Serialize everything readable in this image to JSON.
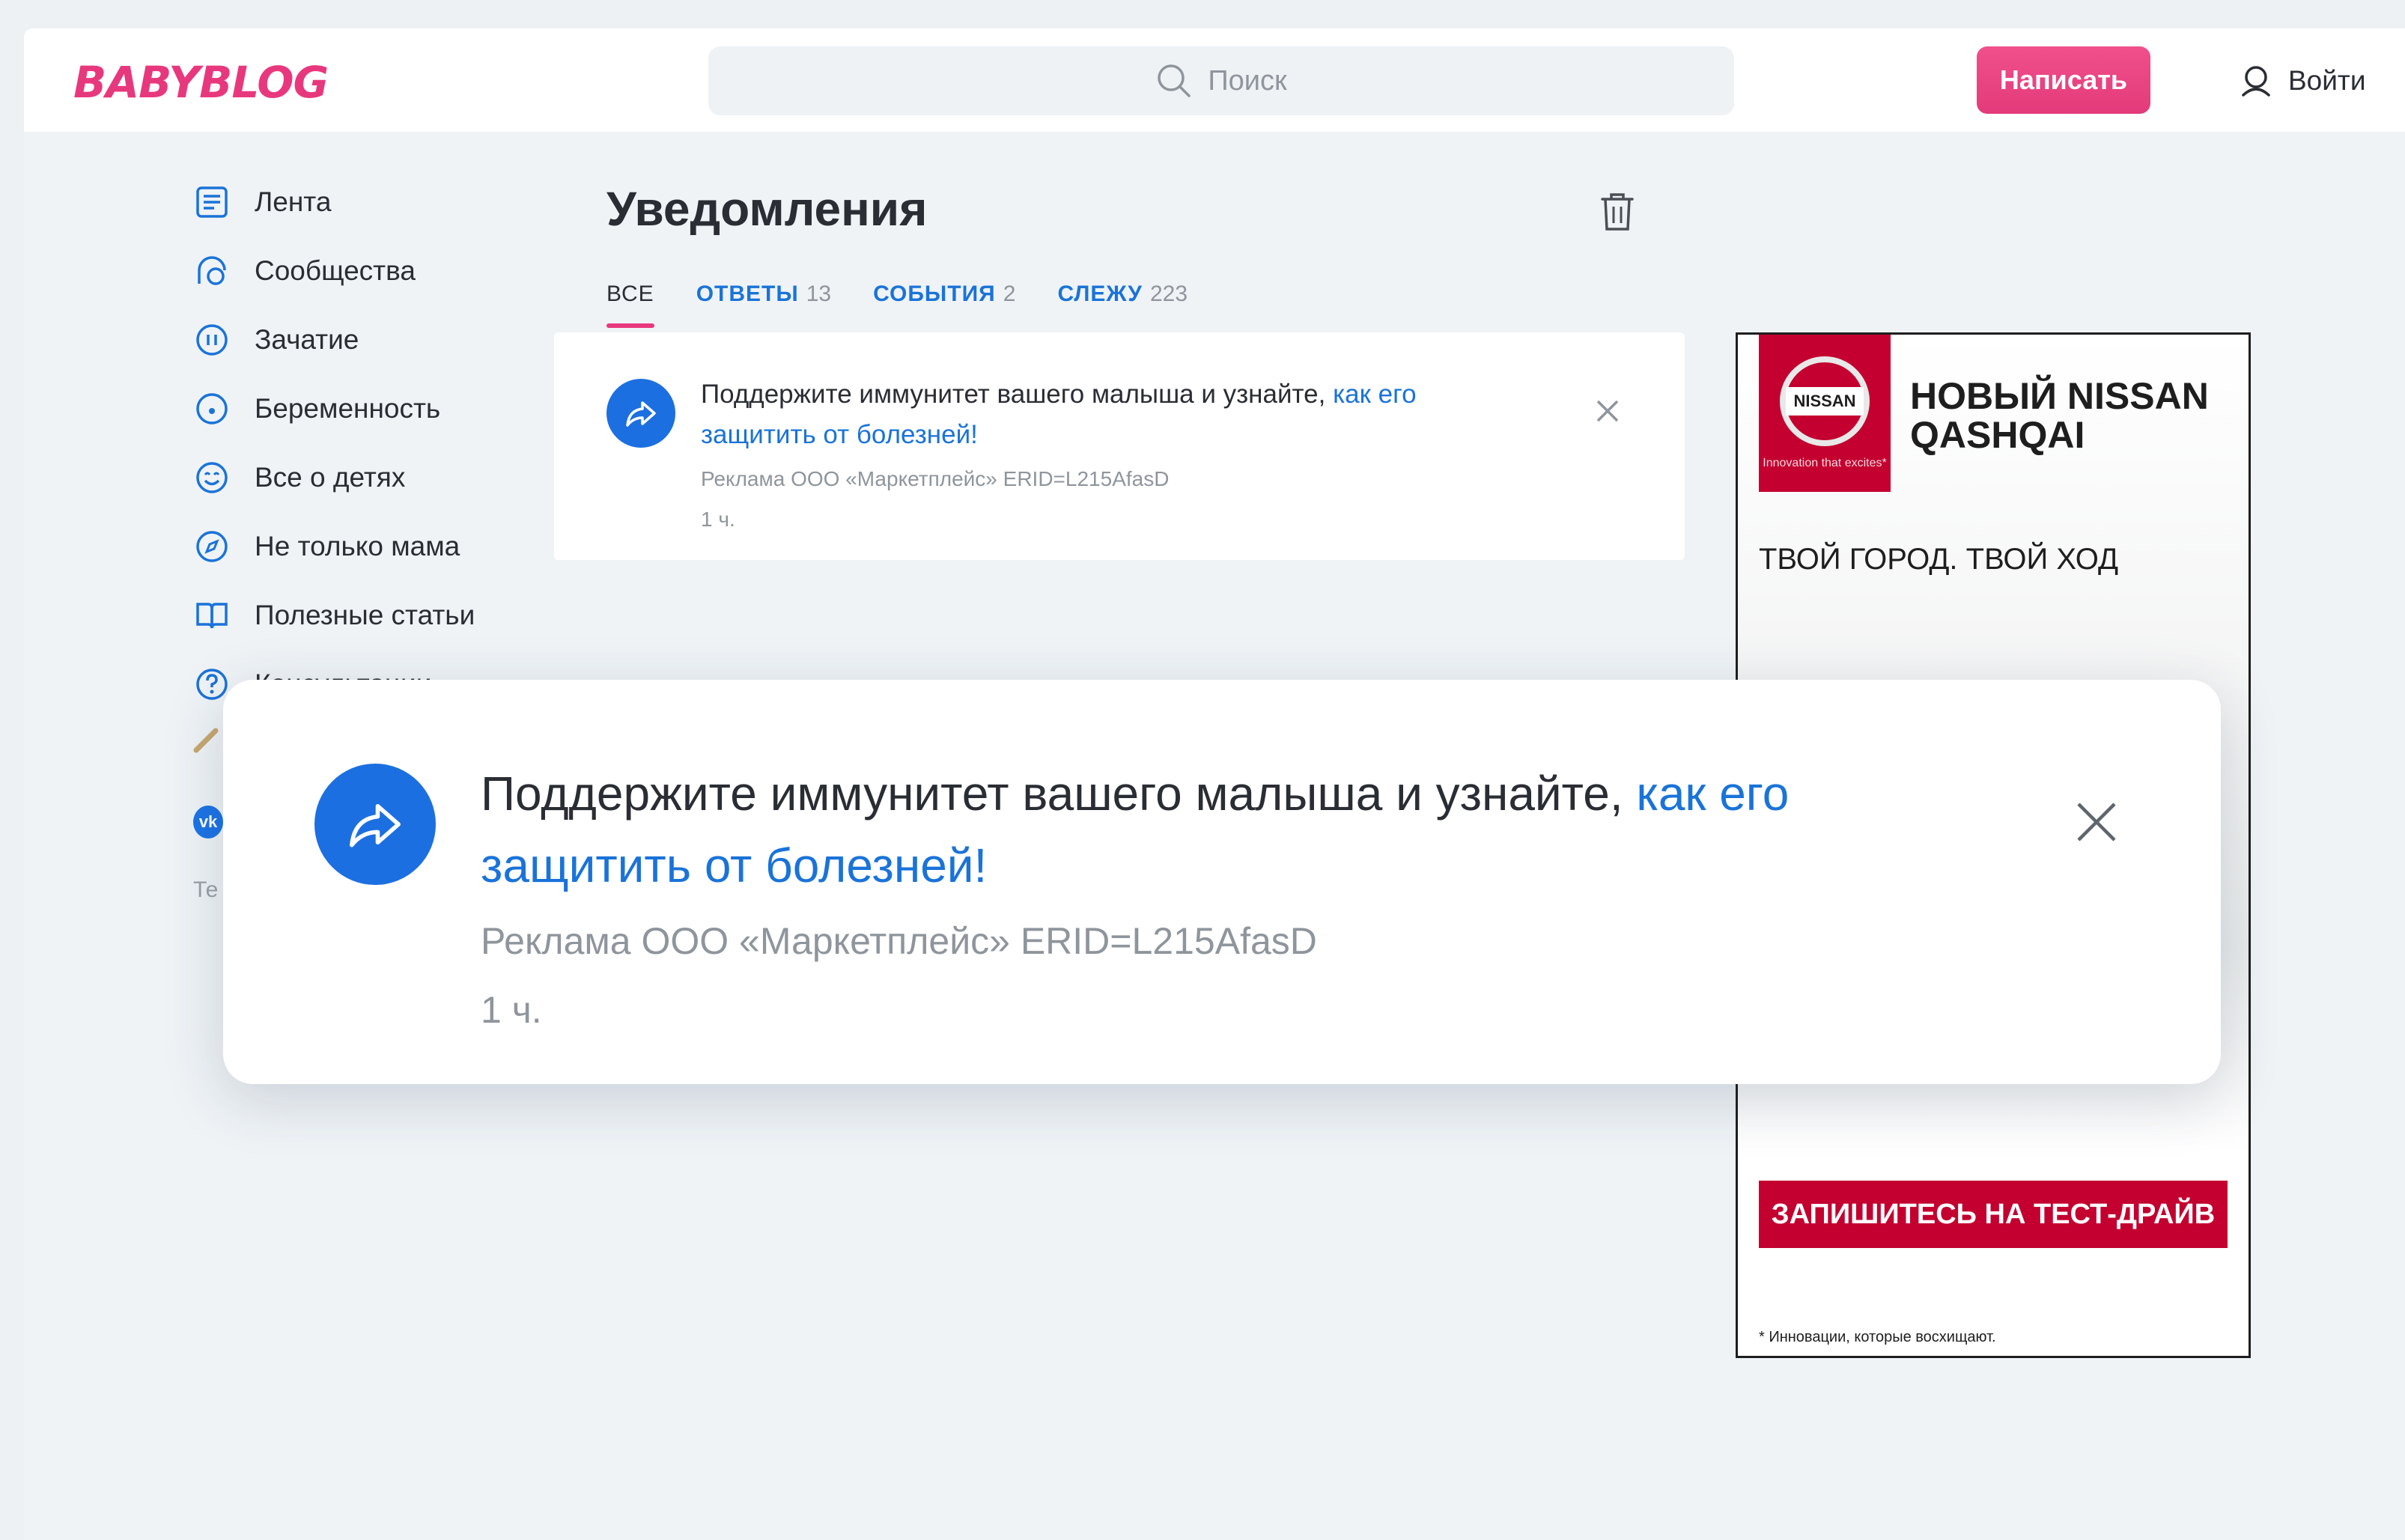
{
  "header": {
    "logo": "BABYBLOG",
    "search_placeholder": "Поиск",
    "write_label": "Написать",
    "login_label": "Войти"
  },
  "sidebar": {
    "items": [
      {
        "label": "Лента",
        "icon": "feed-icon"
      },
      {
        "label": "Сообщества",
        "icon": "communities-icon"
      },
      {
        "label": "Зачатие",
        "icon": "conception-icon"
      },
      {
        "label": "Беременность",
        "icon": "pregnancy-icon"
      },
      {
        "label": "Все о детях",
        "icon": "smile-icon"
      },
      {
        "label": "Не только мама",
        "icon": "compass-icon"
      },
      {
        "label": "Полезные статьи",
        "icon": "book-icon"
      },
      {
        "label": "Консультации",
        "icon": "question-icon"
      }
    ],
    "vk_label": "vk",
    "footer_text": "Те"
  },
  "main": {
    "title": "Уведомления",
    "tabs": [
      {
        "label": "ВСЕ",
        "count": ""
      },
      {
        "label": "ОТВЕТЫ",
        "count": "13"
      },
      {
        "label": "СОБЫТИЯ",
        "count": "2"
      },
      {
        "label": "СЛЕЖУ",
        "count": "223"
      }
    ],
    "notification": {
      "text": "Поддержите иммунитет вашего малыша и узнайте, ",
      "link": "как его защитить от болезней!",
      "meta": "Реклама  ООО «Маркетплейс»  ERID=L215AfasD",
      "time": "1 ч."
    }
  },
  "ad": {
    "brand": "NISSAN",
    "brand_tagline": "Innovation that excites*",
    "headline": "НОВЫЙ NISSAN QASHQAI",
    "slogan": "ТВОЙ ГОРОД. ТВОЙ ХОД",
    "cta": "ЗАПИШИТЕСЬ НА ТЕСТ-ДРАЙВ",
    "footnote": "* Инновации, которые восхищают."
  },
  "colors": {
    "accent_pink": "#e8387d",
    "link_blue": "#1a73d9",
    "nissan_red": "#c3002f"
  }
}
